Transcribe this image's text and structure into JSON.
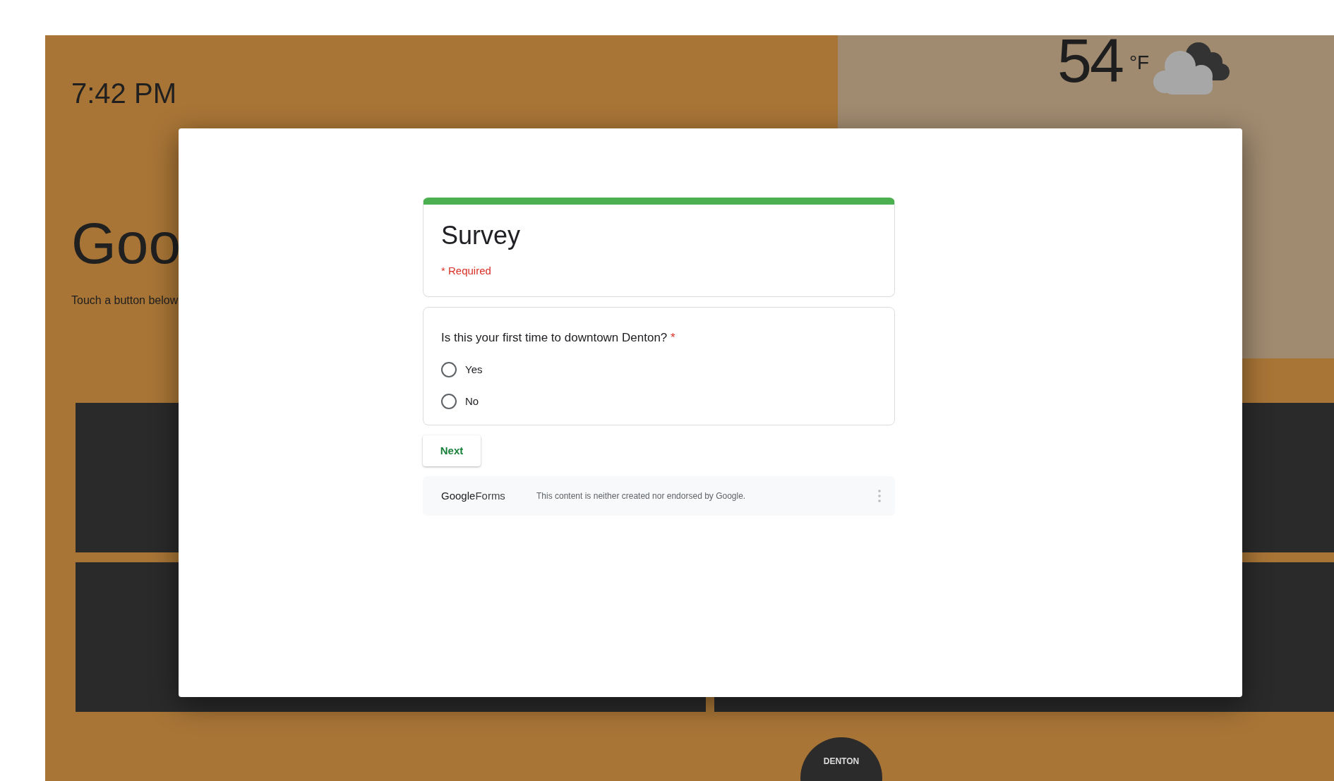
{
  "background": {
    "time": "7:42 PM",
    "greeting": "Goo",
    "instruction": "Touch a button below",
    "weather": {
      "temperature": "54",
      "unit": "°F"
    },
    "badge": {
      "text": "DENTON"
    }
  },
  "form": {
    "title": "Survey",
    "required_note": "* Required",
    "question": {
      "text": "Is this your first time to downtown Denton?",
      "required_mark": "*",
      "options": [
        {
          "label": "Yes",
          "selected": false
        },
        {
          "label": "No",
          "selected": false
        }
      ]
    },
    "next_button": "Next",
    "footer": {
      "brand": "**Google**Forms",
      "disclaimer": "This content is neither created nor endorsed by Google."
    }
  }
}
